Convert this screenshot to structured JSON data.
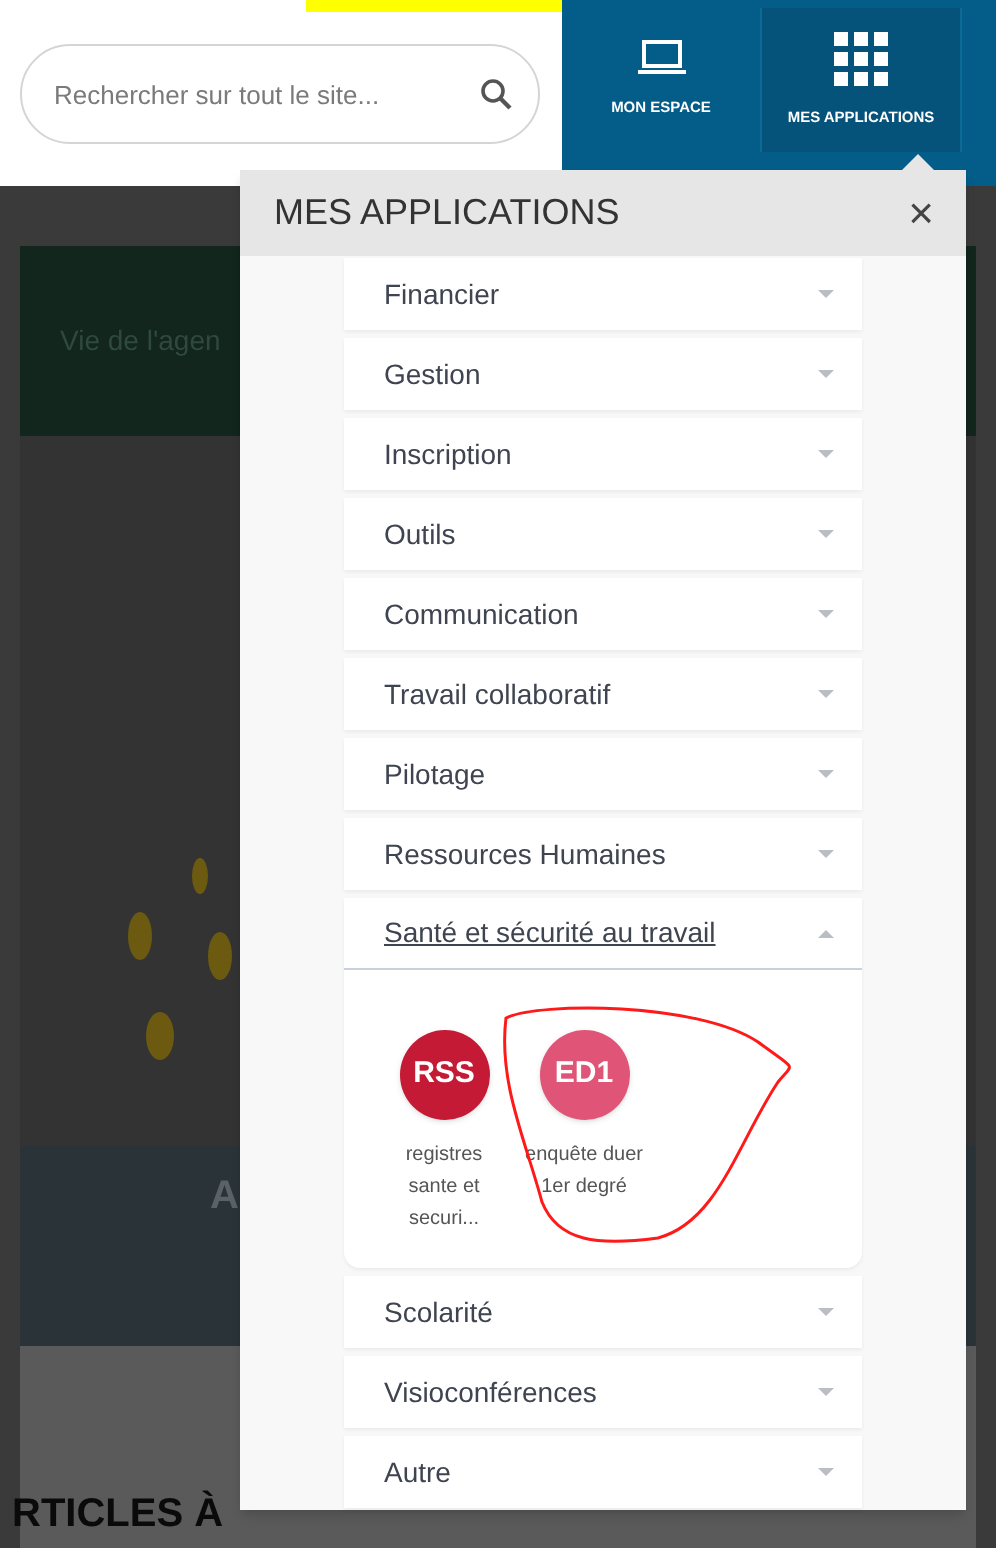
{
  "search": {
    "placeholder": "Rechercher sur tout le site..."
  },
  "nav": [
    {
      "label": "MON ESPACE",
      "kind": "laptop",
      "selected": false
    },
    {
      "label": "MES APPLICATIONS",
      "kind": "grid",
      "selected": true
    }
  ],
  "background": {
    "banner_text": "Vie de l'agen",
    "slide_text": "A",
    "section_title": "RTICLES À"
  },
  "modal": {
    "title": "MES APPLICATIONS",
    "close": "×",
    "categories": [
      {
        "label": "Financier",
        "expanded": false
      },
      {
        "label": "Gestion",
        "expanded": false
      },
      {
        "label": "Inscription",
        "expanded": false
      },
      {
        "label": "Outils",
        "expanded": false
      },
      {
        "label": "Communication",
        "expanded": false
      },
      {
        "label": "Travail collaboratif",
        "expanded": false
      },
      {
        "label": "Pilotage",
        "expanded": false
      },
      {
        "label": "Ressources Humaines",
        "expanded": false
      },
      {
        "label": "Santé et sécurité au travail",
        "expanded": true,
        "apps": [
          {
            "code": "RSS",
            "label": "registres sante et securi...",
            "color": "#c41a35"
          },
          {
            "code": "ED1",
            "label": "enquête duer 1er degré",
            "color": "#e05577"
          }
        ]
      },
      {
        "label": "Scolarité",
        "expanded": false
      },
      {
        "label": "Visioconférences",
        "expanded": false
      },
      {
        "label": "Autre",
        "expanded": false
      }
    ]
  }
}
